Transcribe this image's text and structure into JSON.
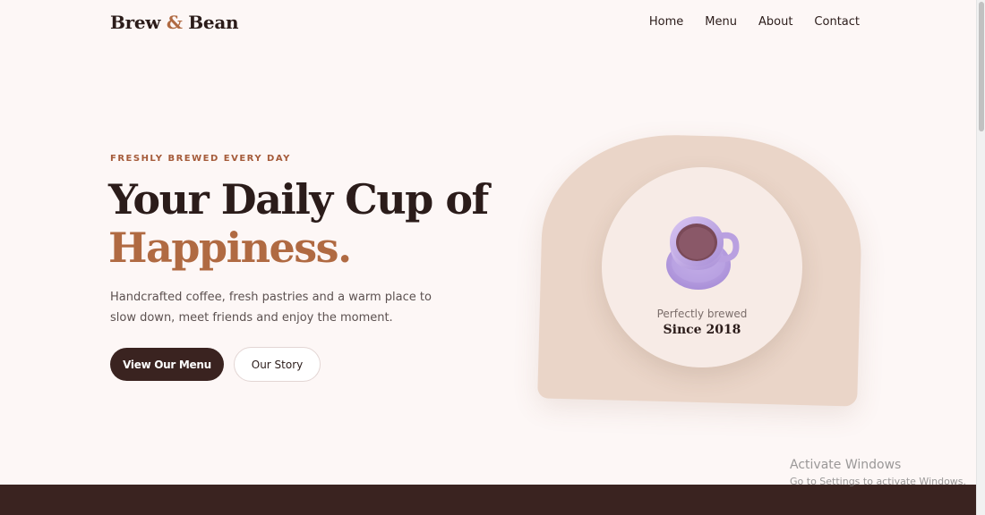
{
  "brand": {
    "name_part1": "Brew",
    "amp": "&",
    "name_part2": "Bean"
  },
  "nav": [
    {
      "label": "Home"
    },
    {
      "label": "Menu"
    },
    {
      "label": "About"
    },
    {
      "label": "Contact"
    }
  ],
  "hero": {
    "eyebrow": "FRESHLY BREWED EVERY DAY",
    "headline_line1": "Your Daily Cup of",
    "headline_line2": "Happiness.",
    "description": "Handcrafted coffee, fresh pastries and a warm place to slow down, meet friends and enjoy the moment.",
    "primary_button": "View Our Menu",
    "secondary_button": "Our Story"
  },
  "feature_card": {
    "caption": "Perfectly brewed",
    "since": "Since 2018",
    "icon": "coffee-cup-icon"
  },
  "windows_watermark": {
    "line1": "Activate Windows",
    "line2": "Go to Settings to activate Windows."
  },
  "colors": {
    "accent": "#b06a42",
    "dark": "#3a2320",
    "background": "#fdf7f6",
    "card": "#ead5c8",
    "plate": "#f7ebe6"
  }
}
